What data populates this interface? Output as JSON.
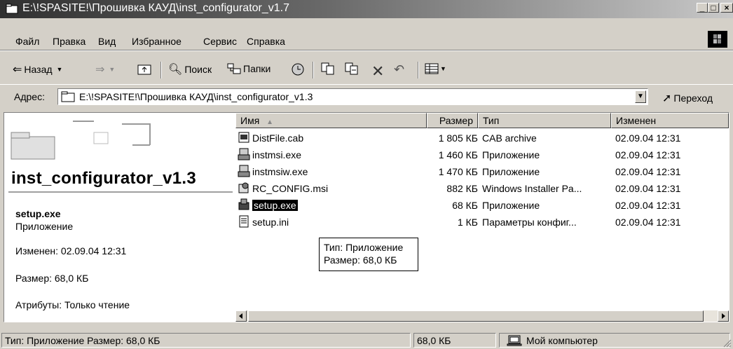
{
  "window": {
    "title": "E:\\!SPASITE!\\Прошивка КАУД\\inst_configurator_v1.7"
  },
  "menu": [
    "Файл",
    "Правка",
    "Вид",
    "Избранное",
    "Сервис",
    "Справка"
  ],
  "toolbar": {
    "back": "Назад",
    "search": "Поиск",
    "folders": "Папки"
  },
  "address": {
    "label": "Адрес:",
    "value": "E:\\!SPASITE!\\Прошивка КАУД\\inst_configurator_v1.3",
    "go": "Переход"
  },
  "left_pane": {
    "folder_name": "inst_configurator_v1.3",
    "selected_file": "setup.exe",
    "selected_type": "Приложение",
    "modified": "Изменен: 02.09.04 12:31",
    "size": "Размер: 68,0 КБ",
    "attributes": "Атрибуты: Только чтение"
  },
  "list": {
    "columns": [
      "Имя",
      "Размер",
      "Тип",
      "Изменен"
    ],
    "rows": [
      {
        "name": "DistFile.cab",
        "size": "1 805 КБ",
        "type": "CAB archive",
        "modified": "02.09.04 12:31",
        "icon": "cab-file-icon"
      },
      {
        "name": "instmsi.exe",
        "size": "1 460 КБ",
        "type": "Приложение",
        "modified": "02.09.04 12:31",
        "icon": "installer-exe-icon"
      },
      {
        "name": "instmsiw.exe",
        "size": "1 470 КБ",
        "type": "Приложение",
        "modified": "02.09.04 12:31",
        "icon": "installer-exe-icon"
      },
      {
        "name": "RC_CONFIG.msi",
        "size": "882 КБ",
        "type": "Windows Installer Pa...",
        "modified": "02.09.04 12:31",
        "icon": "msi-package-icon"
      },
      {
        "name": "setup.exe",
        "size": "68 КБ",
        "type": "Приложение",
        "modified": "02.09.04 12:31",
        "icon": "setup-exe-icon",
        "selected": true
      },
      {
        "name": "setup.ini",
        "size": "1 КБ",
        "type": "Параметры конфиг...",
        "modified": "02.09.04 12:31",
        "icon": "ini-file-icon"
      }
    ]
  },
  "tooltip": {
    "line1": "Тип: Приложение",
    "line2": "Размер: 68,0 КБ"
  },
  "status": {
    "info": "Тип: Приложение Размер: 68,0 КБ",
    "size": "68,0 КБ",
    "location": "Мой компьютер"
  }
}
